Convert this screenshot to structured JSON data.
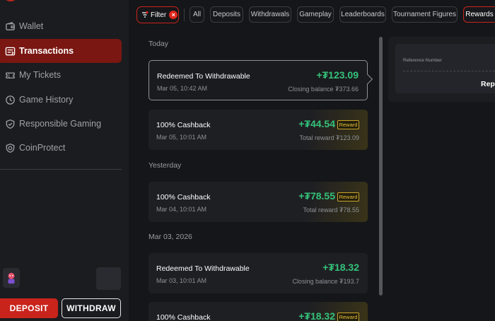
{
  "sidebar": {
    "items": [
      {
        "label": "Wallet",
        "icon": "wallet-icon"
      },
      {
        "label": "Transactions",
        "icon": "transactions-icon",
        "active": true
      },
      {
        "label": "My Tickets",
        "icon": "ticket-icon"
      },
      {
        "label": "Game History",
        "icon": "clock-icon"
      },
      {
        "label": "Responsible Gaming",
        "icon": "shield-check-icon"
      },
      {
        "label": "CoinProtect",
        "icon": "shield-coin-icon"
      }
    ],
    "deposit_label": "DEPOSIT",
    "withdraw_label": "WITHDRAW"
  },
  "filter": {
    "label": "Filter",
    "tabs": [
      "All",
      "Deposits",
      "Withdrawals",
      "Gameplay",
      "Leaderboards",
      "Tournament Figures",
      "Rewards"
    ],
    "active_tab": "Rewards"
  },
  "transactions": {
    "sections": [
      {
        "label": "Today",
        "items": [
          {
            "title": "Redeemed To Withdrawable",
            "date": "Mar 05, 10:42 AM",
            "amount": "+₮123.09",
            "sub": "Closing balance ₮373.66",
            "selected": true
          },
          {
            "title": "100% Cashback",
            "date": "Mar 05, 10:01 AM",
            "amount": "+₮44.54",
            "badge": "Reward",
            "sub": "Total reward ₮123.09"
          }
        ]
      },
      {
        "label": "Yesterday",
        "items": [
          {
            "title": "100% Cashback",
            "date": "Mar 04, 10:01 AM",
            "amount": "+₮78.55",
            "badge": "Reward",
            "sub": "Total reward ₮78.55"
          }
        ]
      },
      {
        "label": "Mar 03, 2026",
        "items": [
          {
            "title": "Redeemed To Withdrawable",
            "date": "Mar 03, 10:01 AM",
            "amount": "+₮18.32",
            "sub": "Closing balance ₮193.7"
          },
          {
            "title": "100% Cashback",
            "amount": "+₮18.32",
            "badge": "Reward"
          }
        ]
      }
    ]
  },
  "detail": {
    "reference_label": "Reference Number",
    "title": "Repo"
  },
  "colors": {
    "accent": "#c8241c",
    "positive": "#34c27a",
    "reward_badge": "#e2bd38"
  }
}
